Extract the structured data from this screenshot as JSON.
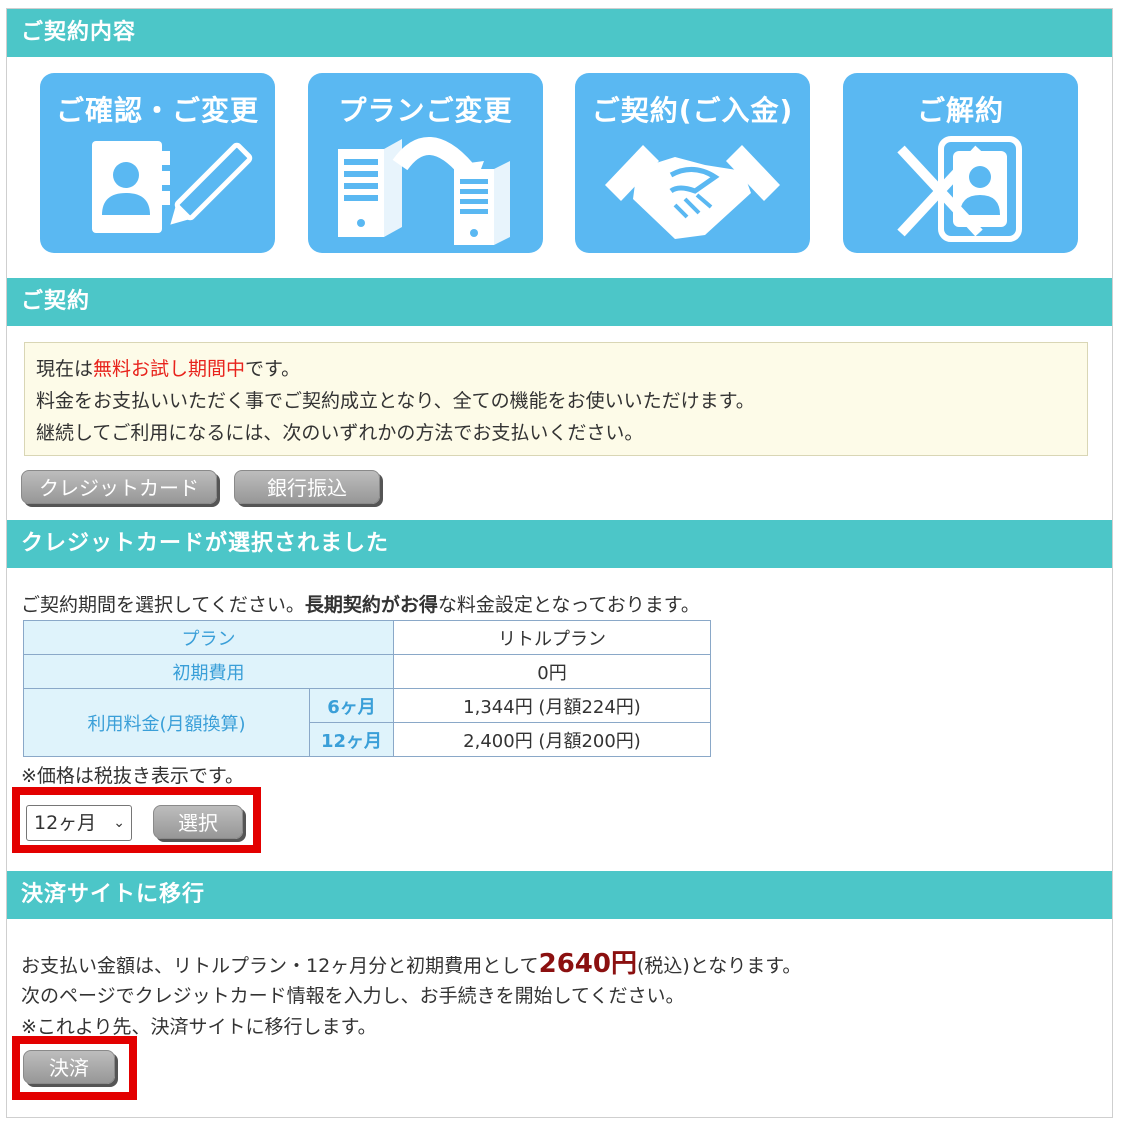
{
  "headers": {
    "contract_details": "ご契約内容",
    "contract": "ご契約",
    "credit_selected": "クレジットカードが選択されました",
    "payment_site": "決済サイトに移行"
  },
  "tiles": [
    {
      "label": "ご確認・ご変更",
      "icon": "contact-edit-icon"
    },
    {
      "label": "プランご変更",
      "icon": "server-swap-icon"
    },
    {
      "label": "ご契約(ご入金)",
      "icon": "handshake-icon"
    },
    {
      "label": "ご解約",
      "icon": "cancel-contact-icon"
    }
  ],
  "notice": {
    "line1_pre": "現在は",
    "line1_red": "無料お試し期間中",
    "line1_post": "です。",
    "line2": "料金をお支払いいただく事でご契約成立となり、全ての機能をお使いいただけます。",
    "line3": "継続してご利用になるには、次のいずれかの方法でお支払いください。"
  },
  "payment_buttons": {
    "credit": "クレジットカード",
    "bank": "銀行振込"
  },
  "period": {
    "intro_pre": "ご契約期間を選択してください。",
    "intro_bold": "長期契約がお得",
    "intro_post": "な料金設定となっております。"
  },
  "plan_table": {
    "plan_label": "プラン",
    "plan_value": "リトルプラン",
    "initial_label": "初期費用",
    "initial_value": "0円",
    "fee_label": "利用料金(月額換算)",
    "rows": [
      {
        "term": "6ヶ月",
        "price": "1,344円 (月額224円)"
      },
      {
        "term": "12ヶ月",
        "price": "2,400円 (月額200円)"
      }
    ]
  },
  "tax_note": "※価格は税抜き表示です。",
  "select": {
    "value": "12ヶ月",
    "button": "選択"
  },
  "payment": {
    "line1_pre": "お支払い金額は、リトルプラン・12ヶ月分と初期費用として",
    "amount": "2640円",
    "line1_tax": "(税込)",
    "line1_post": "となります。",
    "line2": "次のページでクレジットカード情報を入力し、お手続きを開始してください。",
    "line3": "※これより先、決済サイトに移行します。",
    "button": "決済"
  },
  "colors": {
    "header": "#4cc6c8",
    "tile": "#5ab8f2",
    "highlight": "#e30000",
    "amount": "#8b1010"
  }
}
